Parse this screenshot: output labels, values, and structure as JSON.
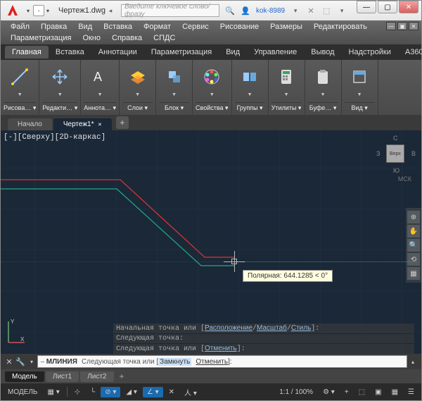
{
  "titlebar": {
    "filename": "Чертеж1.dwg",
    "search_placeholder": "Введите ключевое слово/фразу",
    "user": "kok-8989"
  },
  "menu": [
    "Файл",
    "Правка",
    "Вид",
    "Вставка",
    "Формат",
    "Сервис",
    "Рисование",
    "Размеры",
    "Редактировать",
    "Параметризация",
    "Окно",
    "Справка",
    "СПДС"
  ],
  "ribbon_tabs": [
    "Главная",
    "Вставка",
    "Аннотации",
    "Параметризация",
    "Вид",
    "Управление",
    "Вывод",
    "Надстройки",
    "A360"
  ],
  "ribbon_panels": [
    {
      "label": "Рисова…",
      "icon": "line"
    },
    {
      "label": "Редакти…",
      "icon": "move"
    },
    {
      "label": "Аннота…",
      "icon": "text"
    },
    {
      "label": "Слои",
      "icon": "layers"
    },
    {
      "label": "Блок",
      "icon": "block"
    },
    {
      "label": "Свойства",
      "icon": "palette"
    },
    {
      "label": "Группы",
      "icon": "group"
    },
    {
      "label": "Утилиты",
      "icon": "calc"
    },
    {
      "label": "Буфе…",
      "icon": "clipboard"
    },
    {
      "label": "Вид",
      "icon": "view"
    }
  ],
  "doc_tabs": {
    "home": "Начало",
    "active": "Чертеж1*"
  },
  "viewport": {
    "label": "[-][Сверху][2D-каркас]",
    "cube_face": "Верх",
    "dir_n": "С",
    "dir_e": "В",
    "dir_s": "Ю",
    "dir_w": "З",
    "msk": "МСК"
  },
  "tooltip": "Полярная: 644.1285 < 0°",
  "cmd_history": [
    {
      "pre": "Начальная точка или [",
      "opts": [
        "Расположение",
        "Масштаб",
        "Стиль"
      ],
      "post": "]:"
    },
    {
      "pre": "Следующая точка:",
      "opts": [],
      "post": ""
    },
    {
      "pre": "Следующая точка или [",
      "opts": [
        "Отменить"
      ],
      "post": "]:"
    }
  ],
  "cmd_prompt": {
    "cmd": "МЛИНИЯ",
    "text": "Следующая точка или [",
    "opt1": "Замкнуть",
    "opt2": "Отменить",
    "post": "]:"
  },
  "layout_tabs": [
    "Модель",
    "Лист1",
    "Лист2"
  ],
  "status": {
    "model": "МОДЕЛЬ",
    "scale": "1:1 / 100%"
  }
}
